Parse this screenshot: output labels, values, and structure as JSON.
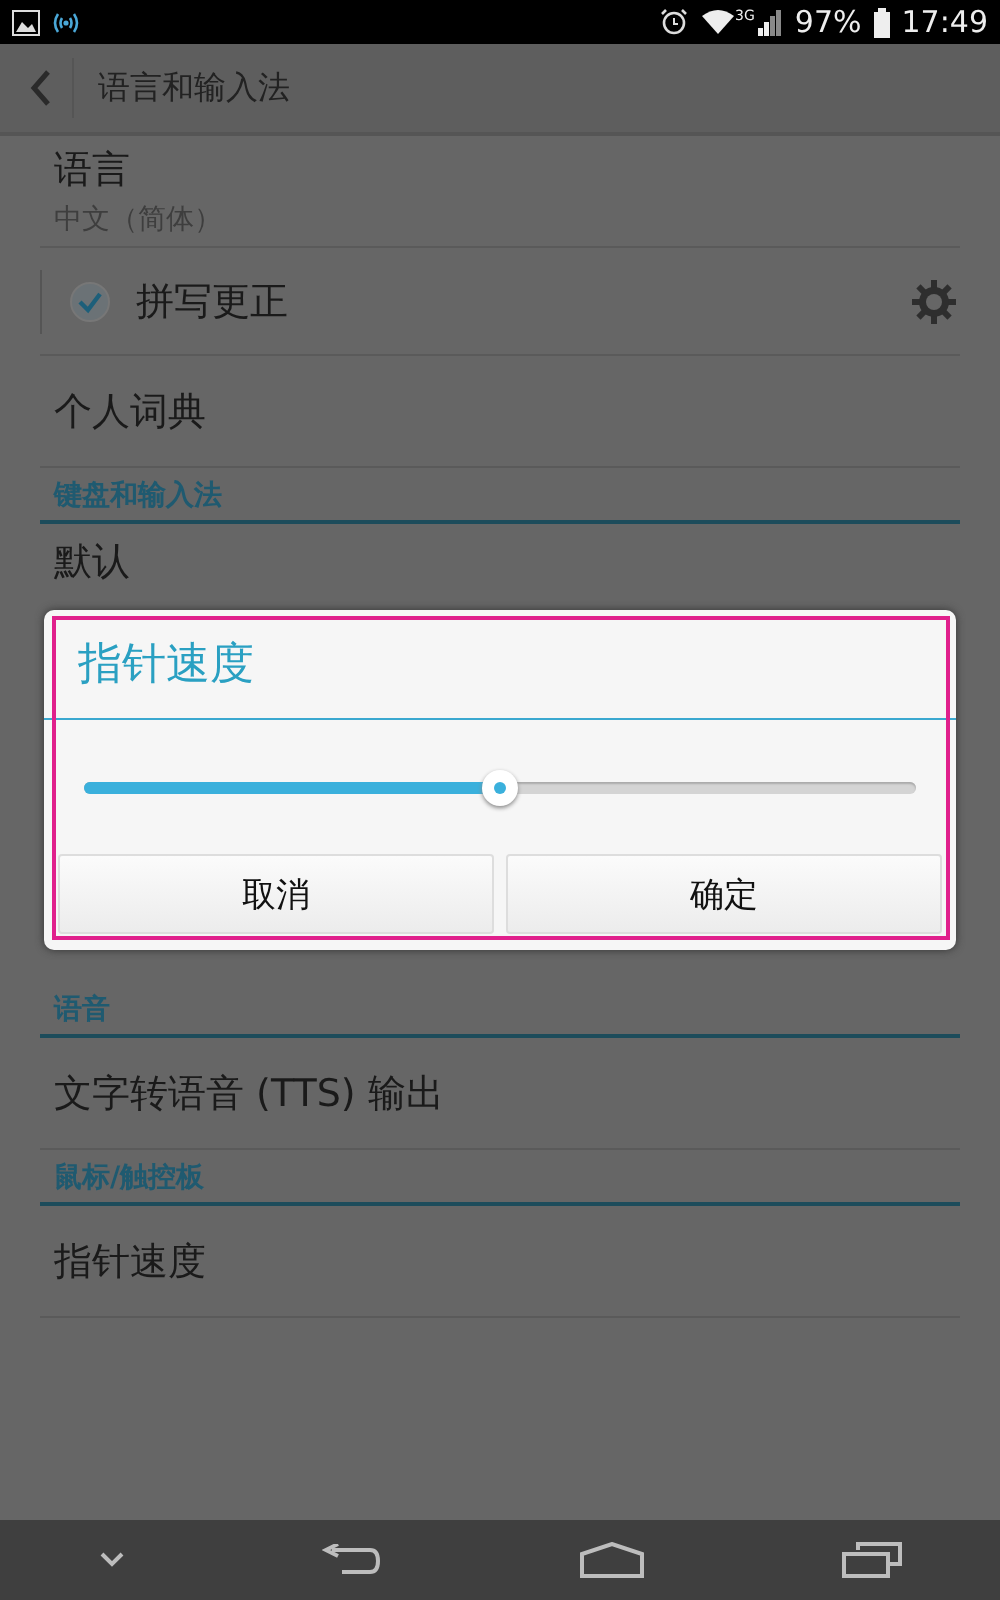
{
  "status_bar": {
    "network": "3G",
    "battery": "97%",
    "time": "17:49"
  },
  "action_bar": {
    "title": "语言和输入法"
  },
  "list_top": [
    {
      "kind": "two_line",
      "title": "语言",
      "subtitle": "中文（简体）"
    },
    {
      "kind": "checkbox",
      "title": "拼写更正",
      "checked": true
    },
    {
      "kind": "single",
      "title": "个人词典"
    },
    {
      "kind": "header",
      "title": "键盘和输入法"
    },
    {
      "kind": "single",
      "title": "默认"
    }
  ],
  "dialog": {
    "title": "指针速度",
    "slider": {
      "level": 0.5
    },
    "buttons": [
      "取消",
      "确定"
    ]
  },
  "list_bottom": [
    {
      "kind": "header",
      "title": "语音"
    },
    {
      "kind": "single",
      "title": "文字转语音 (TTS) 输出"
    },
    {
      "kind": "header",
      "title": "鼠标/触控板"
    },
    {
      "kind": "single",
      "title": "指针速度"
    }
  ]
}
